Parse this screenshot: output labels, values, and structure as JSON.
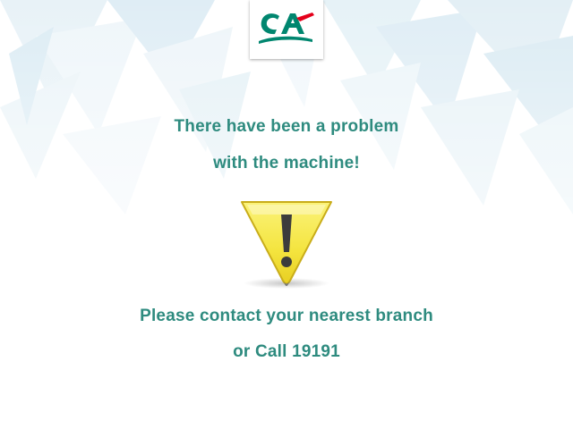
{
  "screen": {
    "message_line_1": "There have been a problem",
    "message_line_2": "with the machine!",
    "contact_line_1": "Please contact your nearest branch",
    "contact_line_2": "or Call 19191"
  },
  "logo": {
    "text": "CA",
    "colors": {
      "primary": "#00866f",
      "accent": "#e4001b"
    }
  },
  "icons": {
    "warning": "warning-triangle-icon"
  },
  "colors": {
    "message_text": "#2e8b7f",
    "warning_yellow": "#f6e84a"
  }
}
